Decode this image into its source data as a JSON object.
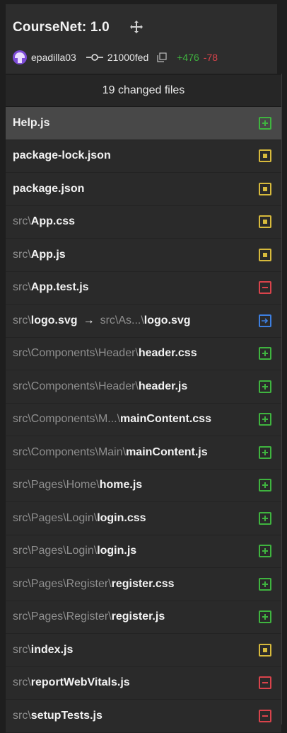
{
  "header": {
    "title": "CourseNet: 1.0",
    "author": "epadilla03",
    "commit_sha": "21000fed",
    "additions": "+476",
    "deletions": "-78"
  },
  "changed_files_label": "19 changed files",
  "colors": {
    "added": "#3fb43f",
    "modified": "#d7ba3c",
    "deleted": "#d9434b",
    "renamed": "#3d7fe0"
  },
  "files": [
    {
      "dir": "",
      "name": "Help.js",
      "status": "added",
      "selected": true
    },
    {
      "dir": "",
      "name": "package-lock.json",
      "status": "modified"
    },
    {
      "dir": "",
      "name": "package.json",
      "status": "modified"
    },
    {
      "dir": "src\\",
      "name": "App.css",
      "status": "modified"
    },
    {
      "dir": "src\\",
      "name": "App.js",
      "status": "modified"
    },
    {
      "dir": "src\\",
      "name": "App.test.js",
      "status": "deleted"
    },
    {
      "dir": "src\\",
      "name": "logo.svg",
      "status": "renamed",
      "new_dir": "src\\As...\\",
      "new_name": "logo.svg"
    },
    {
      "dir": "src\\Components\\Header\\",
      "name": "header.css",
      "status": "added"
    },
    {
      "dir": "src\\Components\\Header\\",
      "name": "header.js",
      "status": "added"
    },
    {
      "dir": "src\\Components\\M...\\",
      "name": "mainContent.css",
      "status": "added"
    },
    {
      "dir": "src\\Components\\Main\\",
      "name": "mainContent.js",
      "status": "added"
    },
    {
      "dir": "src\\Pages\\Home\\",
      "name": "home.js",
      "status": "added"
    },
    {
      "dir": "src\\Pages\\Login\\",
      "name": "login.css",
      "status": "added"
    },
    {
      "dir": "src\\Pages\\Login\\",
      "name": "login.js",
      "status": "added"
    },
    {
      "dir": "src\\Pages\\Register\\",
      "name": "register.css",
      "status": "added"
    },
    {
      "dir": "src\\Pages\\Register\\",
      "name": "register.js",
      "status": "added"
    },
    {
      "dir": "src\\",
      "name": "index.js",
      "status": "modified"
    },
    {
      "dir": "src\\",
      "name": "reportWebVitals.js",
      "status": "deleted"
    },
    {
      "dir": "src\\",
      "name": "setupTests.js",
      "status": "deleted"
    }
  ]
}
